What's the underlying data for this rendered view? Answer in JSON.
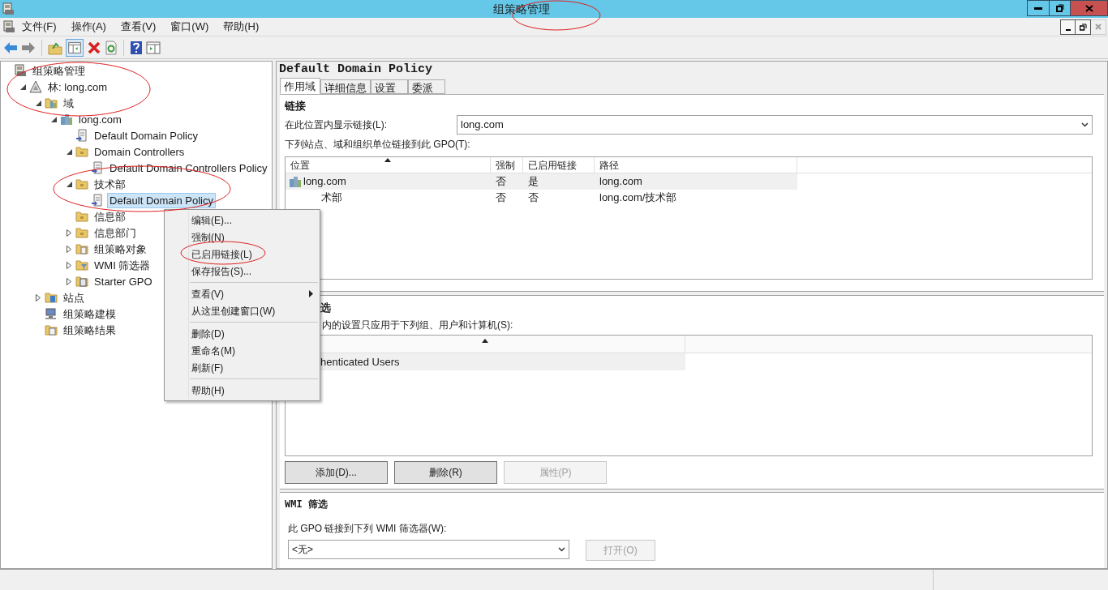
{
  "window": {
    "title": "组策略管理"
  },
  "menu_bar": [
    "文件(F)",
    "操作(A)",
    "查看(V)",
    "窗口(W)",
    "帮助(H)"
  ],
  "tree": [
    {
      "label": "组策略管理",
      "kind": "console",
      "selected": false,
      "children": [
        {
          "label": "林: long.com",
          "kind": "forest",
          "selected": false,
          "expanded": true,
          "children": [
            {
              "label": "域",
              "kind": "domains",
              "selected": false,
              "expanded": true,
              "children": [
                {
                  "label": "long.com",
                  "kind": "domain",
                  "selected": false,
                  "expanded": true,
                  "children": [
                    {
                      "label": "Default Domain Policy",
                      "kind": "link",
                      "selected": false
                    },
                    {
                      "label": "Domain Controllers",
                      "kind": "ou",
                      "selected": false,
                      "expanded": true,
                      "children": [
                        {
                          "label": "Default Domain Controllers Policy",
                          "kind": "link",
                          "selected": false
                        }
                      ]
                    },
                    {
                      "label": "技术部",
                      "kind": "ou",
                      "selected": false,
                      "expanded": true,
                      "children": [
                        {
                          "label": "Default Domain Policy",
                          "kind": "link",
                          "selected": true
                        }
                      ]
                    },
                    {
                      "label": "信息部",
                      "kind": "ou",
                      "selected": false
                    },
                    {
                      "label": "信息部门",
                      "kind": "ou",
                      "selected": false,
                      "expanded": false
                    },
                    {
                      "label": "组策略对象",
                      "kind": "gpofolder",
                      "selected": false,
                      "expanded": false
                    },
                    {
                      "label": "WMI 筛选器",
                      "kind": "wmi",
                      "selected": false,
                      "expanded": false
                    },
                    {
                      "label": "Starter GPO",
                      "kind": "starter",
                      "selected": false,
                      "expanded": false
                    }
                  ]
                }
              ]
            },
            {
              "label": "站点",
              "kind": "sites",
              "selected": false,
              "expanded": false
            },
            {
              "label": "组策略建模",
              "kind": "modeling",
              "selected": false
            },
            {
              "label": "组策略结果",
              "kind": "results",
              "selected": false
            }
          ]
        }
      ]
    }
  ],
  "detail": {
    "title": "Default Domain Policy",
    "tabs": [
      {
        "label": "作用域",
        "selected": true
      },
      {
        "label": "详细信息",
        "selected": false
      },
      {
        "label": "设置",
        "selected": false
      },
      {
        "label": "委派",
        "selected": false
      }
    ],
    "links": {
      "heading": "链接",
      "location_label": "在此位置内显示链接(L):",
      "location_value": "long.com",
      "table_label": "下列站点、域和组织单位链接到此 GPO(T):",
      "columns": [
        "位置",
        "强制",
        "已启用链接",
        "路径"
      ],
      "rows": [
        {
          "cells": [
            "long.com",
            "否",
            "是",
            "long.com"
          ],
          "selected": true,
          "icon": true
        },
        {
          "cells": [
            "术部",
            "否",
            "否",
            "long.com/技术部"
          ],
          "selected": false,
          "icon": false
        }
      ]
    },
    "security": {
      "heading": "选",
      "label": "内的设置只应用于下列组、用户和计算机(S):",
      "rows": [
        {
          "name": "henticated Users",
          "selected": true
        }
      ],
      "buttons": [
        {
          "label": "添加(D)...",
          "disabled": false
        },
        {
          "label": "删除(R)",
          "disabled": false
        },
        {
          "label": "属性(P)",
          "disabled": true
        }
      ]
    },
    "wmi": {
      "heading": "WMI 筛选",
      "label": "此 GPO 链接到下列 WMI 筛选器(W):",
      "value": "<无>",
      "button": {
        "label": "打开(O)",
        "disabled": true
      }
    }
  },
  "context_menu": {
    "groups": [
      [
        {
          "label": "编辑(E)..."
        },
        {
          "label": "强制(N)"
        },
        {
          "label": "已启用链接(L)"
        },
        {
          "label": "保存报告(S)..."
        }
      ],
      [
        {
          "label": "查看(V)",
          "submenu": true
        },
        {
          "label": "从这里创建窗口(W)"
        }
      ],
      [
        {
          "label": "删除(D)"
        },
        {
          "label": "重命名(M)"
        },
        {
          "label": "刷新(F)"
        }
      ],
      [
        {
          "label": "帮助(H)"
        }
      ]
    ]
  }
}
